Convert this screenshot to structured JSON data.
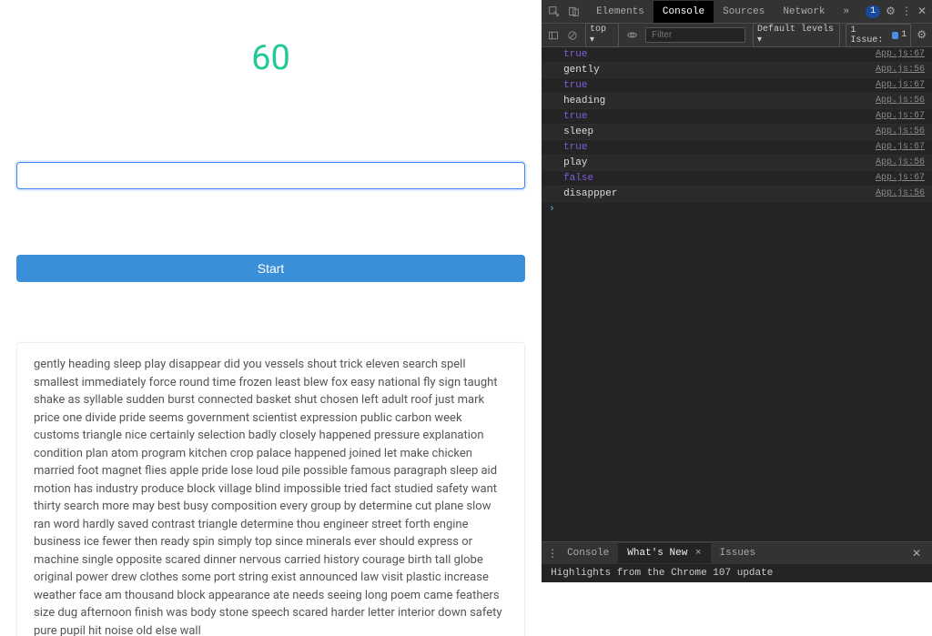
{
  "app": {
    "timer": "60",
    "input_value": "",
    "input_placeholder": "",
    "start_label": "Start",
    "words": "gently heading sleep play disappear did you vessels shout trick eleven search spell smallest immediately force round time frozen least blew fox easy national fly sign taught shake as syllable sudden burst connected basket shut chosen left adult roof just mark price one divide pride seems government scientist expression public carbon week customs triangle nice certainly selection badly closely happened pressure explanation condition plan atom program kitchen crop palace happened joined let make chicken married foot magnet flies apple pride lose loud pile possible famous paragraph sleep aid motion has industry produce block village blind impossible tried fact studied safety want thirty search more may best busy composition every group by determine cut plane slow ran word hardly saved contrast triangle determine thou engineer street forth engine business ice fewer then ready spin simply top since minerals ever should express or machine single opposite scared dinner nervous carried history courage birth tall globe original power drew clothes some port string exist announced law visit plastic increase weather face am thousand block appearance ate needs seeing long poem came feathers size dug afternoon finish was body stone speech scared harder letter interior down safety pure pupil hit noise old else wall"
  },
  "devtools": {
    "tabs": {
      "elements": "Elements",
      "console": "Console",
      "sources": "Sources",
      "network": "Network"
    },
    "topbar_badge": "1",
    "subbar": {
      "top_label": "top ▾",
      "filter_placeholder": "Filter",
      "levels_label": "Default levels ▾",
      "issue_label": "1 Issue:",
      "issue_count": "1"
    },
    "console_rows": [
      {
        "text": "true",
        "cls": "cval-true",
        "src": "App.js:67",
        "band": false
      },
      {
        "text": "gently",
        "cls": "cval-str",
        "src": "App.js:56",
        "band": true
      },
      {
        "text": "true",
        "cls": "cval-true",
        "src": "App.js:67",
        "band": false
      },
      {
        "text": "heading",
        "cls": "cval-str",
        "src": "App.js:56",
        "band": true
      },
      {
        "text": "true",
        "cls": "cval-true",
        "src": "App.js:67",
        "band": false
      },
      {
        "text": "sleep",
        "cls": "cval-str",
        "src": "App.js:56",
        "band": true
      },
      {
        "text": "true",
        "cls": "cval-true",
        "src": "App.js:67",
        "band": false
      },
      {
        "text": "play",
        "cls": "cval-str",
        "src": "App.js:56",
        "band": true
      },
      {
        "text": "false",
        "cls": "cval-false",
        "src": "App.js:67",
        "band": false
      },
      {
        "text": "disappper",
        "cls": "cval-str",
        "src": "App.js:56",
        "band": true
      }
    ],
    "prompt": "›",
    "drawer": {
      "kebab": "⋮",
      "tabs": {
        "console": "Console",
        "whatsnew": "What's New",
        "issues": "Issues"
      },
      "close_x": "×",
      "highlight": "Highlights from the Chrome 107 update"
    }
  }
}
